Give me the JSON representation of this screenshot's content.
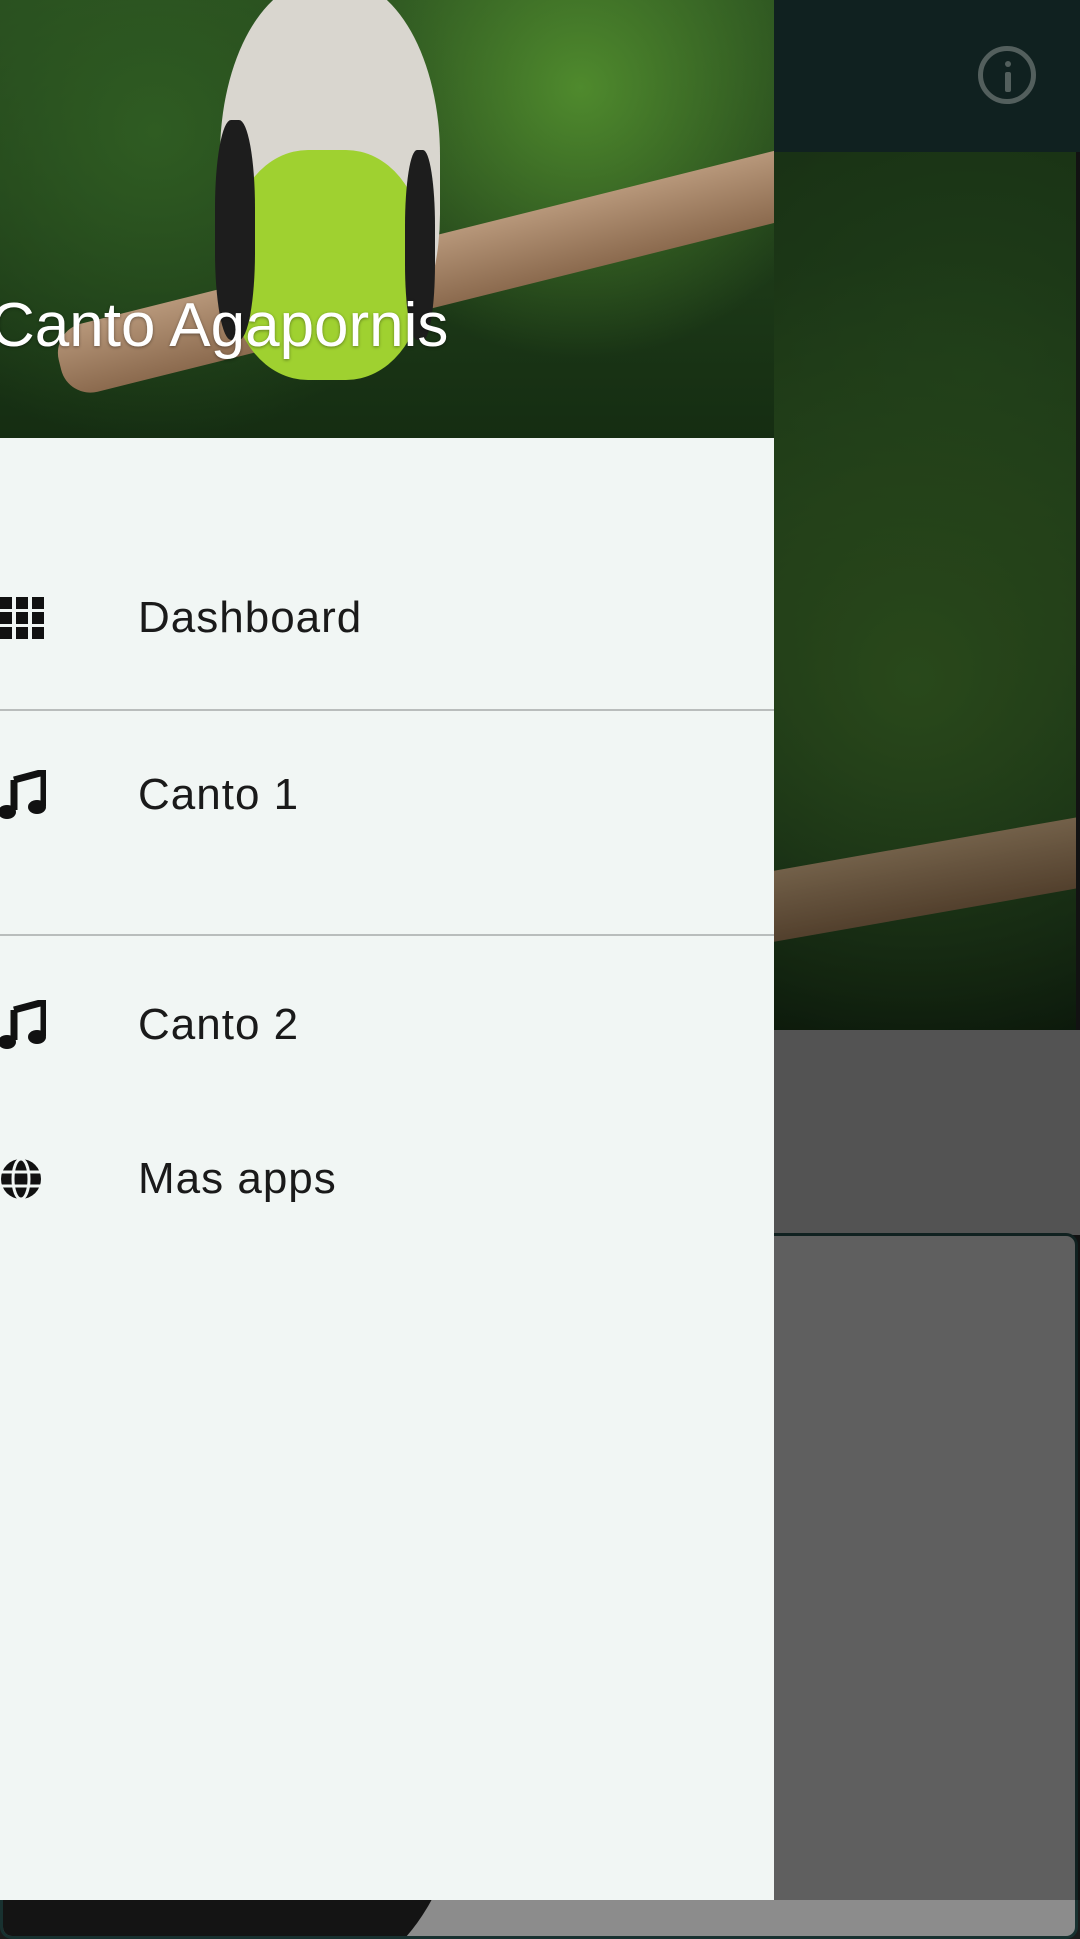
{
  "drawer": {
    "title": "Canto Agapornis",
    "items": [
      {
        "label": "Dashboard",
        "icon": "grid-icon"
      },
      {
        "label": "Canto 1",
        "icon": "music-note-icon"
      },
      {
        "label": "Canto 2",
        "icon": "music-note-icon"
      },
      {
        "label": "Mas apps",
        "icon": "globe-icon"
      }
    ]
  },
  "toolbar": {
    "info_icon": "info-icon",
    "color": "#183130"
  },
  "colors": {
    "drawer_bg": "#f1f6f4",
    "divider": "#b9bdbc",
    "text": "#1a1a1a"
  }
}
